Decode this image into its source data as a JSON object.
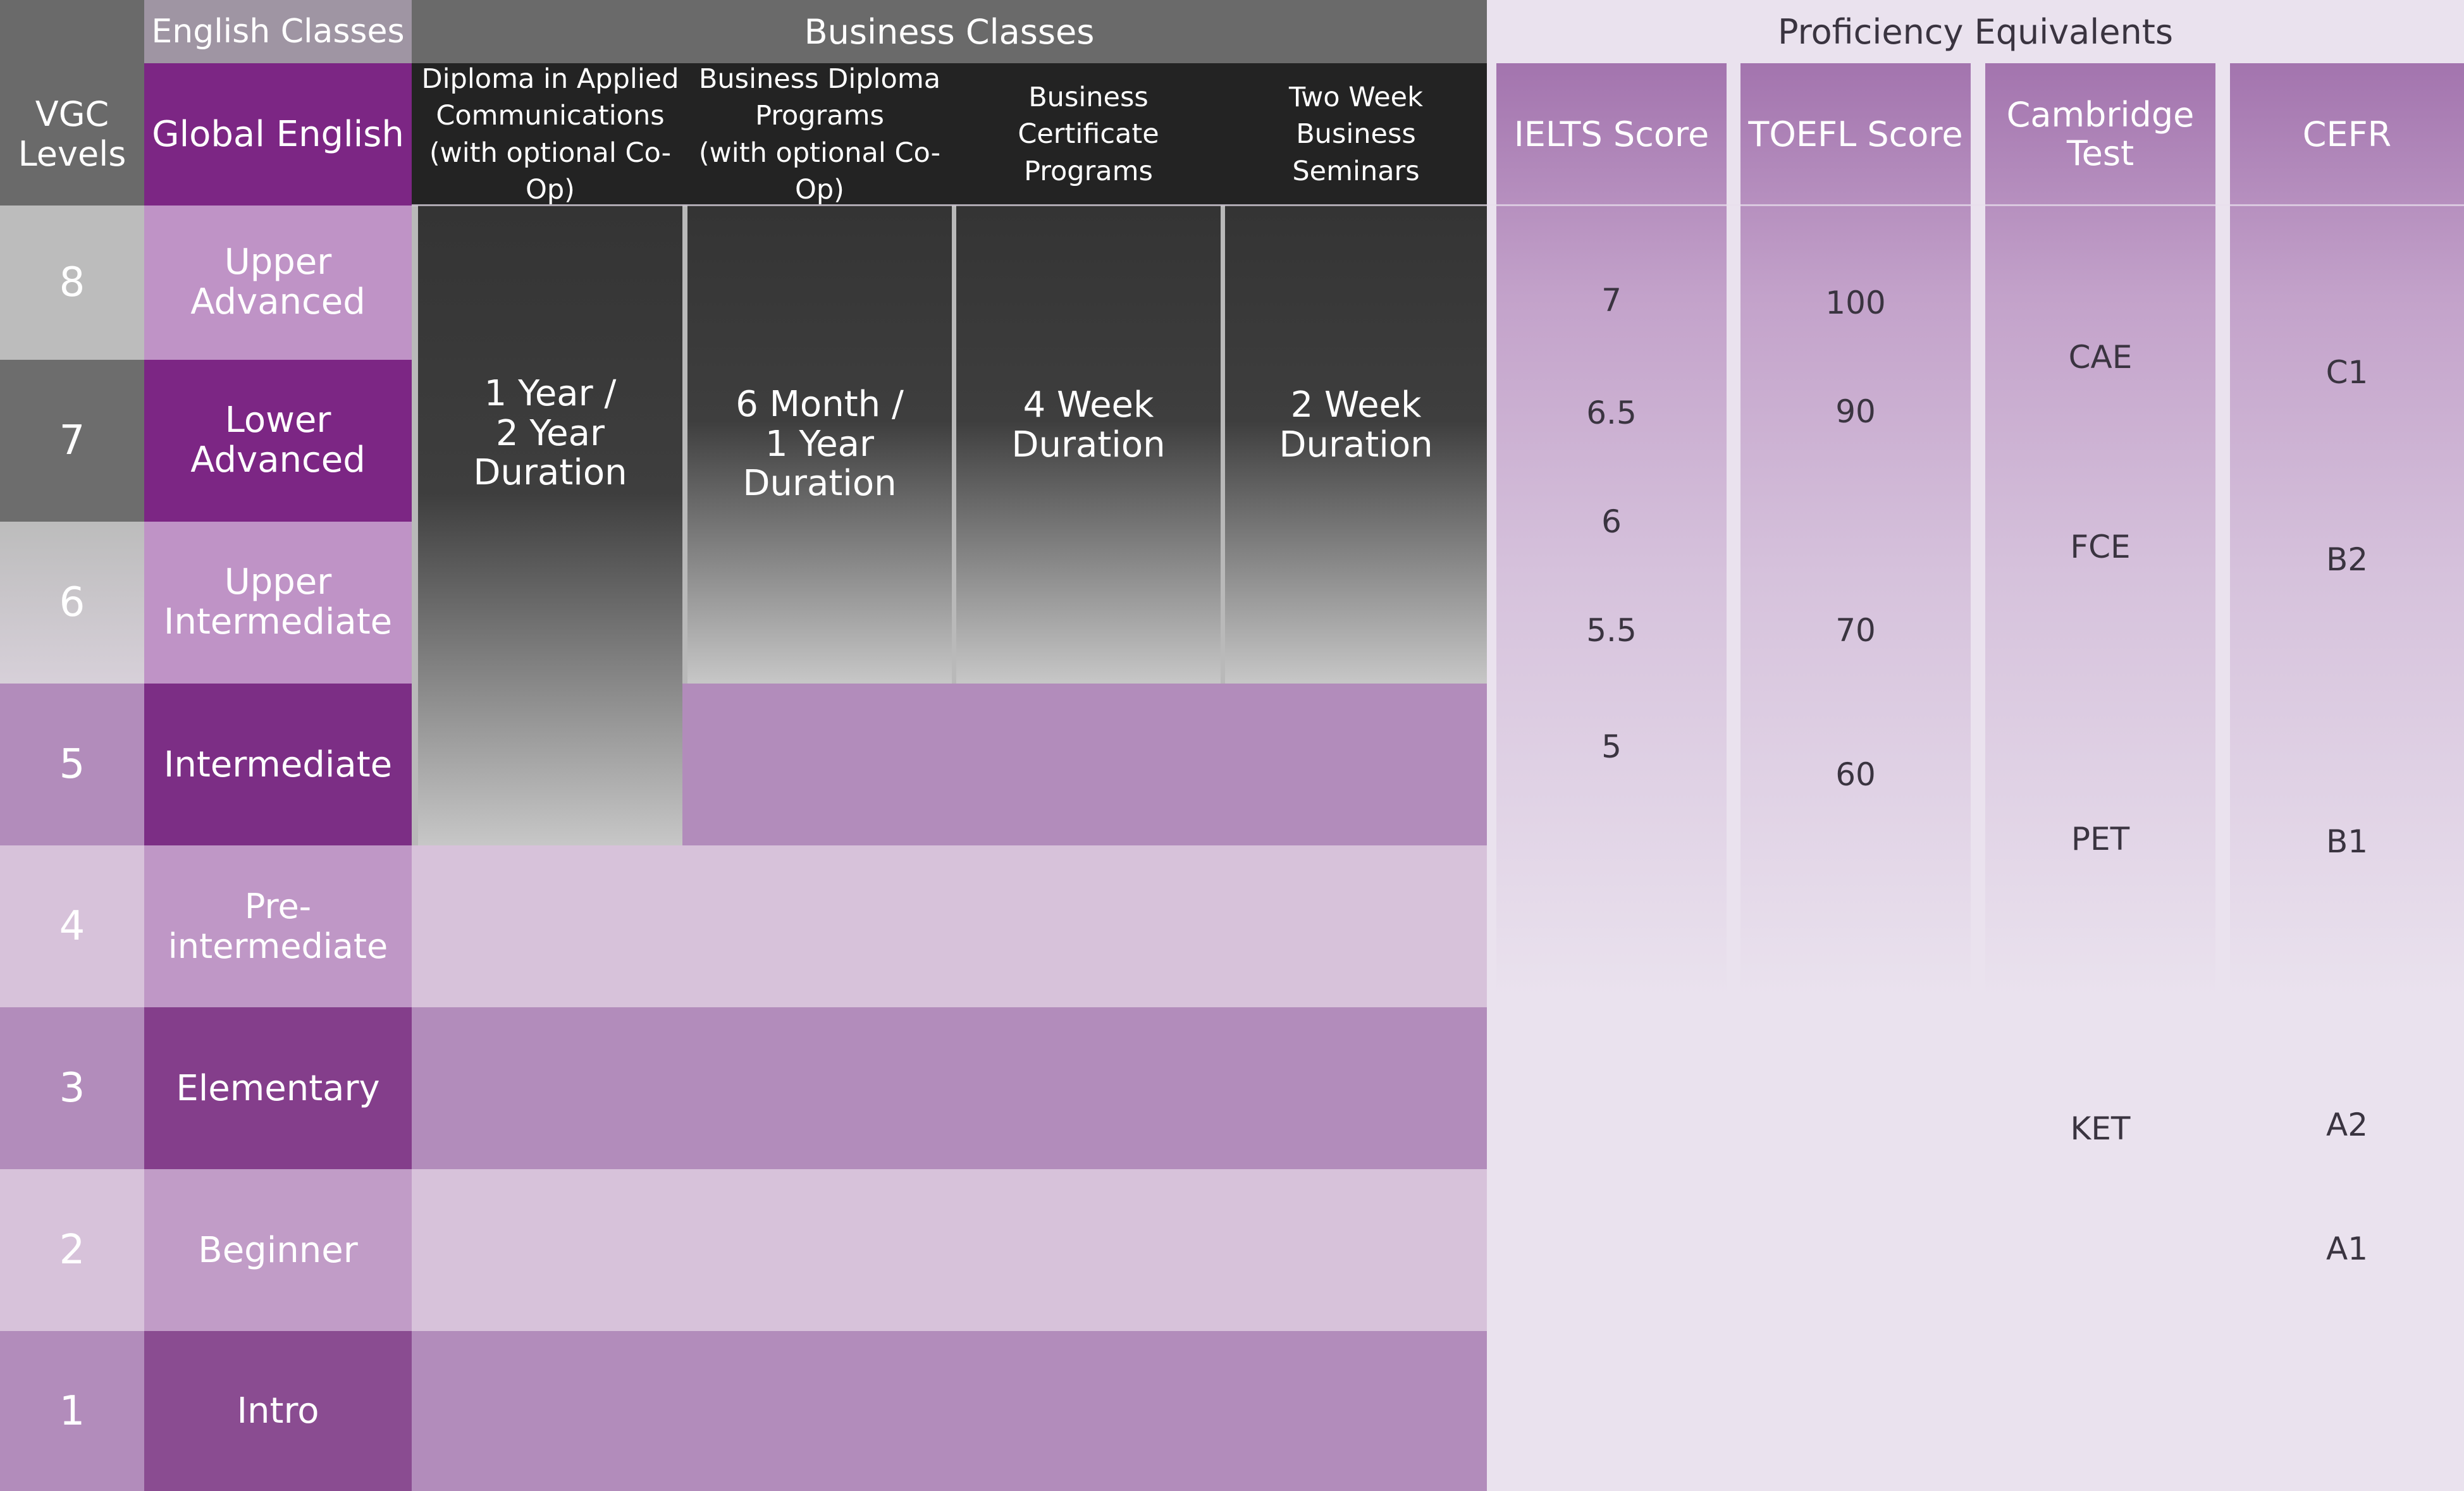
{
  "header": {
    "english_classes": "English Classes",
    "business_classes": "Business Classes",
    "proficiency_equivalents": "Proficiency Equivalents"
  },
  "columns": {
    "vgc_levels": "VGC\nLevels",
    "global_english": "Global English",
    "business": [
      "Diploma in Applied\nCommunications\n(with optional Co-Op)",
      "Business Diploma\nPrograms\n(with optional Co-Op)",
      "Business Certificate\nPrograms",
      "Two Week Business\nSeminars"
    ],
    "proficiency": [
      "IELTS Score",
      "TOEFL Score",
      "Cambridge\nTest",
      "CEFR"
    ]
  },
  "levels": [
    {
      "num": "8",
      "name": "Upper\nAdvanced"
    },
    {
      "num": "7",
      "name": "Lower\nAdvanced"
    },
    {
      "num": "6",
      "name": "Upper\nIntermediate"
    },
    {
      "num": "5",
      "name": "Intermediate"
    },
    {
      "num": "4",
      "name": "Pre-intermediate"
    },
    {
      "num": "3",
      "name": "Elementary"
    },
    {
      "num": "2",
      "name": "Beginner"
    },
    {
      "num": "1",
      "name": "Intro"
    }
  ],
  "durations": [
    "1 Year /\n2 Year\nDuration",
    "6 Month /\n1 Year\nDuration",
    "4 Week\nDuration",
    "2 Week\nDuration"
  ],
  "ielts": [
    "7",
    "6.5",
    "6",
    "5.5",
    "5"
  ],
  "toefl": [
    "100",
    "90",
    "70",
    "60"
  ],
  "cambridge": [
    "CAE",
    "FCE",
    "PET",
    "KET"
  ],
  "cefr": [
    "C1",
    "B2",
    "B1",
    "A2",
    "A1"
  ],
  "colors": {
    "global_english_purple": "#7c2684",
    "vgc_gray": "#6a6a6a",
    "business_black": "#232323",
    "light_band": "#d7c2da",
    "mid_band": "#b28cbb",
    "proficiency_bg": "#eae2ee"
  }
}
